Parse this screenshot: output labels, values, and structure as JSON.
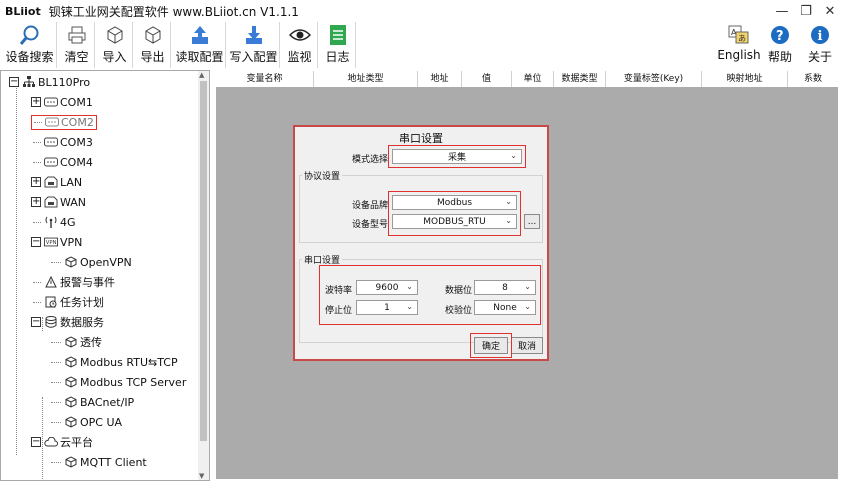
{
  "window": {
    "brand": "BLiiot",
    "title": "钡铼工业网关配置软件 www.BLiiot.cn V1.1.1",
    "minimize": "—",
    "restore": "❐",
    "close": "✕"
  },
  "toolbar": {
    "search": "设备搜索",
    "clear": "清空",
    "import": "导入",
    "export": "导出",
    "read_config": "读取配置",
    "write_config": "写入配置",
    "monitor": "监视",
    "log": "日志",
    "english": "English",
    "help": "帮助",
    "about": "关于"
  },
  "tree": {
    "root": "BL110Pro",
    "items": [
      "COM1",
      "COM2",
      "COM3",
      "COM4",
      "LAN",
      "WAN",
      "4G",
      "VPN",
      "OpenVPN",
      "报警与事件",
      "任务计划",
      "数据服务",
      "透传",
      "Modbus RTU⇆TCP",
      "Modbus TCP Server",
      "BACnet/IP",
      "OPC UA",
      "云平台",
      "MQTT Client"
    ]
  },
  "grid": {
    "columns": [
      "变量名称",
      "地址类型",
      "地址",
      "值",
      "单位",
      "数据类型",
      "变量标签(Key)",
      "映射地址",
      "系数"
    ]
  },
  "dialog": {
    "title": "串口设置",
    "mode_label": "模式选择",
    "mode_value": "采集",
    "protocol_group": "协议设置",
    "brand_label": "设备品牌",
    "brand_value": "Modbus",
    "model_label": "设备型号",
    "model_value": "MODBUS_RTU",
    "more": "...",
    "serial_group": "串口设置",
    "baud_label": "波特率",
    "baud_value": "9600",
    "databits_label": "数据位",
    "databits_value": "8",
    "stopbits_label": "停止位",
    "stopbits_value": "1",
    "parity_label": "校验位",
    "parity_value": "None",
    "ok": "确定",
    "cancel": "取消"
  }
}
